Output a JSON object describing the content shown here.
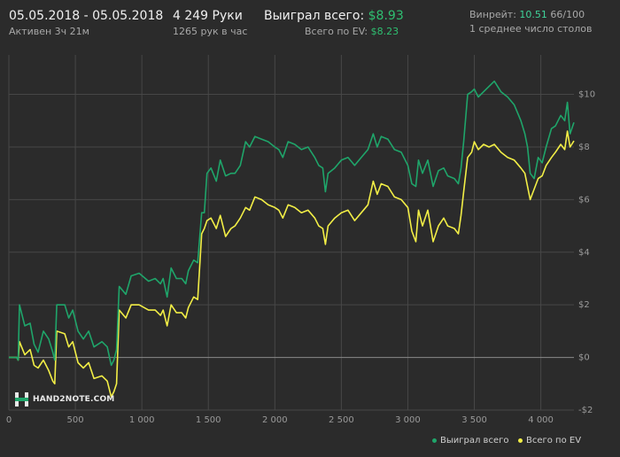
{
  "header": {
    "date_range": "05.05.2018 - 05.05.2018",
    "active": "Активен 3ч 21м",
    "hands": "4 249 Руки",
    "hands_per_hour": "1265 рук в час",
    "won_label": "Выиграл всего:",
    "won_value": "$8.93",
    "ev_label": "Всего по EV:",
    "ev_value": "$8.23",
    "winrate_label": "Винрейт:",
    "winrate_value": "10.51",
    "winrate_suffix": "66/100",
    "tables": "1 среднее число столов"
  },
  "logo": {
    "text": "HAND2NOTE.COM"
  },
  "legend": {
    "won": "Выиграл всего",
    "ev": "Всего по EV"
  },
  "colors": {
    "won": "#1fa56a",
    "ev": "#f2ee46",
    "background": "#2b2b2b",
    "grid": "#474747",
    "zero_line": "#8a8a8a"
  },
  "chart_data": {
    "type": "line",
    "x_ticks": [
      0,
      500,
      1000,
      1500,
      2000,
      2500,
      3000,
      3500,
      4000
    ],
    "x_tick_labels": [
      "0",
      "500",
      "1 000",
      "1 500",
      "2 000",
      "2 500",
      "3 000",
      "3 500",
      "4 000"
    ],
    "y_ticks": [
      -2,
      0,
      2,
      4,
      6,
      8,
      10
    ],
    "y_tick_labels": [
      "-$2",
      "$0",
      "$2",
      "$4",
      "$6",
      "$8",
      "$10"
    ],
    "xlim": [
      0,
      4249
    ],
    "ylim": [
      -2,
      11.5
    ],
    "grid": true,
    "legend_position": "bottom-right",
    "series": [
      {
        "name": "Выиграл всего",
        "points": [
          [
            0,
            0
          ],
          [
            60,
            0
          ],
          [
            70,
            -0.1
          ],
          [
            80,
            2.0
          ],
          [
            120,
            1.2
          ],
          [
            160,
            1.3
          ],
          [
            190,
            0.5
          ],
          [
            220,
            0.2
          ],
          [
            260,
            1.0
          ],
          [
            300,
            0.7
          ],
          [
            330,
            0.2
          ],
          [
            345,
            -0.1
          ],
          [
            360,
            2.0
          ],
          [
            420,
            2.0
          ],
          [
            450,
            1.5
          ],
          [
            480,
            1.8
          ],
          [
            520,
            1.0
          ],
          [
            560,
            0.7
          ],
          [
            600,
            1.0
          ],
          [
            640,
            0.4
          ],
          [
            700,
            0.6
          ],
          [
            740,
            0.4
          ],
          [
            770,
            -0.3
          ],
          [
            790,
            -0.1
          ],
          [
            810,
            0.3
          ],
          [
            830,
            2.7
          ],
          [
            880,
            2.4
          ],
          [
            920,
            3.1
          ],
          [
            980,
            3.2
          ],
          [
            1050,
            2.9
          ],
          [
            1100,
            3.0
          ],
          [
            1140,
            2.8
          ],
          [
            1160,
            3.0
          ],
          [
            1190,
            2.3
          ],
          [
            1220,
            3.4
          ],
          [
            1260,
            3.0
          ],
          [
            1300,
            3.0
          ],
          [
            1330,
            2.8
          ],
          [
            1350,
            3.3
          ],
          [
            1390,
            3.7
          ],
          [
            1420,
            3.6
          ],
          [
            1450,
            5.5
          ],
          [
            1470,
            5.5
          ],
          [
            1490,
            7.0
          ],
          [
            1520,
            7.2
          ],
          [
            1560,
            6.7
          ],
          [
            1590,
            7.5
          ],
          [
            1630,
            6.9
          ],
          [
            1670,
            7.0
          ],
          [
            1700,
            7.0
          ],
          [
            1740,
            7.3
          ],
          [
            1780,
            8.2
          ],
          [
            1810,
            8.0
          ],
          [
            1850,
            8.4
          ],
          [
            1900,
            8.3
          ],
          [
            1950,
            8.2
          ],
          [
            2000,
            8.0
          ],
          [
            2030,
            7.9
          ],
          [
            2060,
            7.6
          ],
          [
            2100,
            8.2
          ],
          [
            2150,
            8.1
          ],
          [
            2200,
            7.9
          ],
          [
            2250,
            8.0
          ],
          [
            2300,
            7.6
          ],
          [
            2330,
            7.3
          ],
          [
            2360,
            7.2
          ],
          [
            2380,
            6.3
          ],
          [
            2400,
            7.0
          ],
          [
            2450,
            7.2
          ],
          [
            2500,
            7.5
          ],
          [
            2550,
            7.6
          ],
          [
            2600,
            7.3
          ],
          [
            2650,
            7.6
          ],
          [
            2700,
            7.9
          ],
          [
            2740,
            8.5
          ],
          [
            2770,
            8.0
          ],
          [
            2800,
            8.4
          ],
          [
            2850,
            8.3
          ],
          [
            2900,
            7.9
          ],
          [
            2950,
            7.8
          ],
          [
            3000,
            7.3
          ],
          [
            3030,
            6.6
          ],
          [
            3060,
            6.5
          ],
          [
            3080,
            7.5
          ],
          [
            3110,
            7.0
          ],
          [
            3150,
            7.5
          ],
          [
            3190,
            6.5
          ],
          [
            3230,
            7.1
          ],
          [
            3270,
            7.2
          ],
          [
            3300,
            6.9
          ],
          [
            3350,
            6.8
          ],
          [
            3380,
            6.6
          ],
          [
            3400,
            7.2
          ],
          [
            3420,
            8.2
          ],
          [
            3450,
            10.0
          ],
          [
            3480,
            10.1
          ],
          [
            3500,
            10.2
          ],
          [
            3530,
            9.9
          ],
          [
            3570,
            10.1
          ],
          [
            3610,
            10.3
          ],
          [
            3650,
            10.5
          ],
          [
            3700,
            10.1
          ],
          [
            3750,
            9.9
          ],
          [
            3800,
            9.6
          ],
          [
            3850,
            9.0
          ],
          [
            3880,
            8.5
          ],
          [
            3900,
            8.0
          ],
          [
            3920,
            7.0
          ],
          [
            3950,
            6.8
          ],
          [
            3980,
            7.6
          ],
          [
            4010,
            7.4
          ],
          [
            4040,
            8.0
          ],
          [
            4080,
            8.7
          ],
          [
            4110,
            8.8
          ],
          [
            4150,
            9.2
          ],
          [
            4180,
            9.0
          ],
          [
            4200,
            9.7
          ],
          [
            4220,
            8.5
          ],
          [
            4249,
            8.93
          ]
        ]
      },
      {
        "name": "Всего по EV",
        "points": [
          [
            0,
            0
          ],
          [
            60,
            0
          ],
          [
            70,
            -0.1
          ],
          [
            80,
            0.6
          ],
          [
            120,
            0.1
          ],
          [
            160,
            0.3
          ],
          [
            190,
            -0.3
          ],
          [
            220,
            -0.4
          ],
          [
            260,
            -0.1
          ],
          [
            300,
            -0.5
          ],
          [
            330,
            -0.9
          ],
          [
            345,
            -1.0
          ],
          [
            360,
            1.0
          ],
          [
            420,
            0.9
          ],
          [
            450,
            0.4
          ],
          [
            480,
            0.6
          ],
          [
            520,
            -0.2
          ],
          [
            560,
            -0.4
          ],
          [
            600,
            -0.2
          ],
          [
            640,
            -0.8
          ],
          [
            700,
            -0.7
          ],
          [
            740,
            -0.9
          ],
          [
            770,
            -1.5
          ],
          [
            790,
            -1.3
          ],
          [
            810,
            -1.0
          ],
          [
            830,
            1.8
          ],
          [
            880,
            1.5
          ],
          [
            920,
            2.0
          ],
          [
            980,
            2.0
          ],
          [
            1050,
            1.8
          ],
          [
            1100,
            1.8
          ],
          [
            1140,
            1.6
          ],
          [
            1160,
            1.8
          ],
          [
            1190,
            1.2
          ],
          [
            1220,
            2.0
          ],
          [
            1260,
            1.7
          ],
          [
            1300,
            1.7
          ],
          [
            1330,
            1.5
          ],
          [
            1350,
            1.9
          ],
          [
            1390,
            2.3
          ],
          [
            1420,
            2.2
          ],
          [
            1450,
            4.7
          ],
          [
            1470,
            4.9
          ],
          [
            1490,
            5.2
          ],
          [
            1520,
            5.3
          ],
          [
            1560,
            4.9
          ],
          [
            1590,
            5.4
          ],
          [
            1630,
            4.6
          ],
          [
            1670,
            4.9
          ],
          [
            1700,
            5.0
          ],
          [
            1740,
            5.3
          ],
          [
            1780,
            5.7
          ],
          [
            1810,
            5.6
          ],
          [
            1850,
            6.1
          ],
          [
            1900,
            6.0
          ],
          [
            1950,
            5.8
          ],
          [
            2000,
            5.7
          ],
          [
            2030,
            5.6
          ],
          [
            2060,
            5.3
          ],
          [
            2100,
            5.8
          ],
          [
            2150,
            5.7
          ],
          [
            2200,
            5.5
          ],
          [
            2250,
            5.6
          ],
          [
            2300,
            5.3
          ],
          [
            2330,
            5.0
          ],
          [
            2360,
            4.9
          ],
          [
            2380,
            4.3
          ],
          [
            2400,
            5.0
          ],
          [
            2450,
            5.3
          ],
          [
            2500,
            5.5
          ],
          [
            2550,
            5.6
          ],
          [
            2600,
            5.2
          ],
          [
            2650,
            5.5
          ],
          [
            2700,
            5.8
          ],
          [
            2740,
            6.7
          ],
          [
            2770,
            6.2
          ],
          [
            2800,
            6.6
          ],
          [
            2850,
            6.5
          ],
          [
            2900,
            6.1
          ],
          [
            2950,
            6.0
          ],
          [
            3000,
            5.7
          ],
          [
            3030,
            4.8
          ],
          [
            3060,
            4.4
          ],
          [
            3080,
            5.6
          ],
          [
            3110,
            5.0
          ],
          [
            3150,
            5.6
          ],
          [
            3190,
            4.4
          ],
          [
            3230,
            5.0
          ],
          [
            3270,
            5.3
          ],
          [
            3300,
            5.0
          ],
          [
            3350,
            4.9
          ],
          [
            3380,
            4.7
          ],
          [
            3400,
            5.4
          ],
          [
            3420,
            6.3
          ],
          [
            3450,
            7.6
          ],
          [
            3480,
            7.8
          ],
          [
            3500,
            8.2
          ],
          [
            3530,
            7.9
          ],
          [
            3570,
            8.1
          ],
          [
            3610,
            8.0
          ],
          [
            3650,
            8.1
          ],
          [
            3700,
            7.8
          ],
          [
            3750,
            7.6
          ],
          [
            3800,
            7.5
          ],
          [
            3850,
            7.2
          ],
          [
            3880,
            7.0
          ],
          [
            3900,
            6.5
          ],
          [
            3920,
            6.0
          ],
          [
            3950,
            6.4
          ],
          [
            3980,
            6.8
          ],
          [
            4010,
            6.9
          ],
          [
            4040,
            7.3
          ],
          [
            4080,
            7.6
          ],
          [
            4110,
            7.8
          ],
          [
            4150,
            8.1
          ],
          [
            4180,
            7.9
          ],
          [
            4200,
            8.6
          ],
          [
            4220,
            8.0
          ],
          [
            4249,
            8.23
          ]
        ]
      }
    ]
  }
}
